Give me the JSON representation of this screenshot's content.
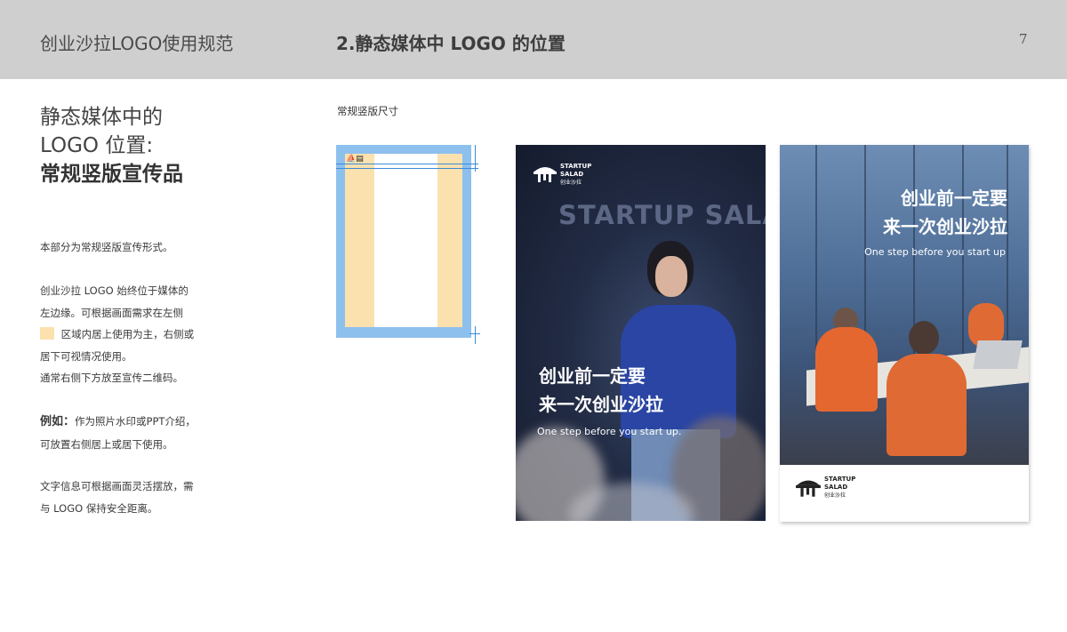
{
  "header": {
    "doc_title": "创业沙拉LOGO使用规范",
    "section_title": "2.静态媒体中 LOGO 的位置",
    "page_number": "7"
  },
  "left": {
    "heading_line1": "静态媒体中的",
    "heading_line2": "LOGO 位置:",
    "heading_line3": "常规竖版宣传品",
    "para1": "本部分为常规竖版宣传形式。",
    "para2_line1": "创业沙拉 LOGO 始终位于媒体的",
    "para2_line2": "左边缘。可根据画面需求在左侧",
    "para2_line3": "区域内居上使用为主，右侧或",
    "para2_line4": "居下可视情况使用。",
    "para2_line5": "通常右侧下方放至宣传二维码。",
    "para3_label": "例如：",
    "para3_line1": "作为照片水印或PPT介绍，",
    "para3_line2": "可放置右侧居上或居下使用。",
    "para4_line1": "文字信息可根据画面灵活摆放，需",
    "para4_line2": "与 LOGO 保持安全距离。"
  },
  "guide": {
    "subhead": "常规竖版尺寸",
    "zone_color": "#fbe1ae",
    "margin_color": "#8ec0ee"
  },
  "brand": {
    "en_line1": "STARTUP",
    "en_line2": "SALAD",
    "cn": "创业沙拉"
  },
  "poster1": {
    "bg_word": "STARTUP SALAD",
    "slogan_line1": "创业前一定要",
    "slogan_line2": "来一次创业沙拉",
    "slogan_en": "One step before you start up."
  },
  "poster2": {
    "slogan_line1": "创业前一定要",
    "slogan_line2": "来一次创业沙拉",
    "slogan_en": "One step before you start up"
  }
}
